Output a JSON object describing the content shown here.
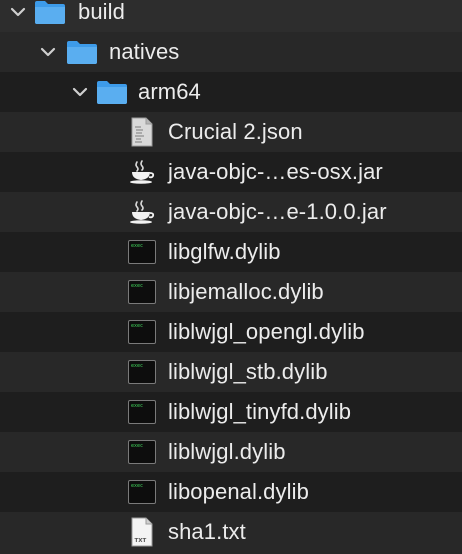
{
  "tree": {
    "build": {
      "label": "build",
      "icon": "folder-icon",
      "expanded": true
    },
    "natives": {
      "label": "natives",
      "icon": "folder-icon",
      "expanded": true
    },
    "arm64": {
      "label": "arm64",
      "icon": "folder-icon",
      "expanded": true
    },
    "files": [
      {
        "label": "Crucial 2.json",
        "icon": "json-document-icon"
      },
      {
        "label": "java-objc-…es-osx.jar",
        "icon": "java-jar-icon"
      },
      {
        "label": "java-objc-…e-1.0.0.jar",
        "icon": "java-jar-icon"
      },
      {
        "label": "libglfw.dylib",
        "icon": "terminal-exec-icon"
      },
      {
        "label": "libjemalloc.dylib",
        "icon": "terminal-exec-icon"
      },
      {
        "label": "liblwjgl_opengl.dylib",
        "icon": "terminal-exec-icon"
      },
      {
        "label": "liblwjgl_stb.dylib",
        "icon": "terminal-exec-icon"
      },
      {
        "label": "liblwjgl_tinyfd.dylib",
        "icon": "terminal-exec-icon"
      },
      {
        "label": "liblwjgl.dylib",
        "icon": "terminal-exec-icon"
      },
      {
        "label": "libopenal.dylib",
        "icon": "terminal-exec-icon"
      },
      {
        "label": "sha1.txt",
        "icon": "txt-document-icon",
        "badge": "TXT"
      }
    ]
  },
  "colors": {
    "folder": "#3d9be9",
    "folder_tab": "#6cb8f2",
    "chevron": "#cfcfcf",
    "text": "#ececec",
    "row_alt": "#282828",
    "background": "#1e1e1e"
  }
}
